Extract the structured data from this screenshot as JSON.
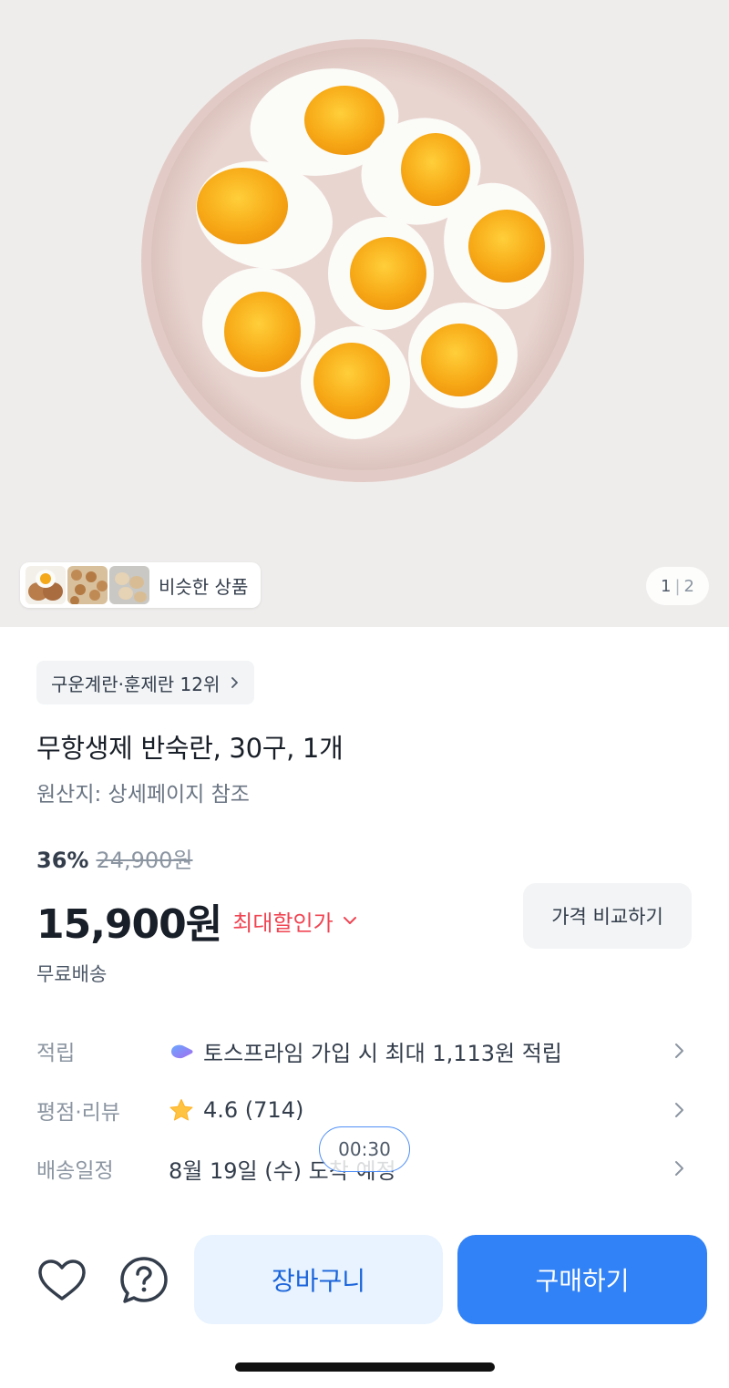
{
  "hero": {
    "similar_label": "비슷한 상품",
    "pager_current": "1",
    "pager_sep": "|",
    "pager_total": "2"
  },
  "product": {
    "rank_chip": "구운계란·훈제란 12위",
    "title": "무항생제 반숙란, 30구, 1개",
    "origin": "원산지: 상세페이지 참조",
    "discount_percent": "36%",
    "original_price": "24,900원",
    "price": "15,900원",
    "max_discount_label": "최대할인가",
    "compare_button": "가격 비교하기",
    "shipping": "무료배송"
  },
  "info_rows": [
    {
      "key": "적립",
      "value": "토스프라임 가입 시 최대 1,113원 적립",
      "icon": "toss-prime-icon"
    },
    {
      "key": "평점·리뷰",
      "value": "4.6 (714)",
      "icon": "star-icon"
    },
    {
      "key": "배송일정",
      "value": "8월 19일 (수) 도착 예정",
      "icon": ""
    }
  ],
  "timer": "00:30",
  "bottom_bar": {
    "cart_button": "장바구니",
    "buy_button": "구매하기"
  },
  "colors": {
    "accent_blue": "#3182f6",
    "cart_bg": "#e8f3ff",
    "discount_red": "#f04452",
    "star": "#ffc342"
  }
}
